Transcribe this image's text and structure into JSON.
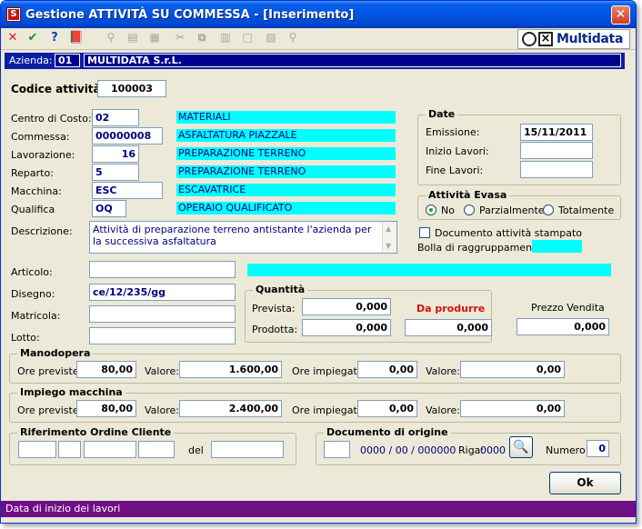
{
  "window": {
    "title": "Gestione ATTIVITÀ SU COMMESSA - [Inserimento]",
    "close_glyph": "✕"
  },
  "toolbar": {
    "buttons": [
      "close-icon",
      "confirm-icon",
      "help-icon",
      "book-icon",
      "binoculars-icon",
      "print-icon",
      "print-preview-icon",
      "cut-icon",
      "copy-icon",
      "paste-icon",
      "new-icon",
      "export-icon",
      "search-icon"
    ],
    "glyphs": [
      "✕",
      "✔",
      "?",
      "📕",
      "⚲",
      "▤",
      "▦",
      "✂",
      "⧉",
      "▥",
      "□",
      "▧",
      "⚲"
    ],
    "logo_text": "Multidata"
  },
  "azienda": {
    "label": "Azienda:",
    "code": "01",
    "name": "MULTIDATA S.r.L."
  },
  "codice": {
    "label": "Codice attività:",
    "value": "100003"
  },
  "fields": {
    "centro_costo": {
      "label": "Centro di Costo:",
      "value": "02",
      "desc": "MATERIALI"
    },
    "commessa": {
      "label": "Commessa:",
      "value": "00000008",
      "desc": "ASFALTATURA PIAZZALE"
    },
    "lavorazione": {
      "label": "Lavorazione:",
      "value": "16",
      "desc": "PREPARAZIONE TERRENO"
    },
    "reparto": {
      "label": "Reparto:",
      "value": "5",
      "desc": "PREPARAZIONE TERRENO"
    },
    "macchina": {
      "label": "Macchina:",
      "value": "ESC",
      "desc": "ESCAVATRICE"
    },
    "qualifica": {
      "label": "Qualifica",
      "value": "OQ",
      "desc": "OPERAIO QUALIFICATO"
    },
    "descrizione": {
      "label": "Descrizione:",
      "value": "Attività di preparazione terreno antistante l'azienda per la successiva asfaltatura"
    },
    "articolo": {
      "label": "Articolo:",
      "value": ""
    },
    "disegno": {
      "label": "Disegno:",
      "value": "ce/12/235/gg"
    },
    "matricola": {
      "label": "Matricola:",
      "value": ""
    },
    "lotto": {
      "label": "Lotto:",
      "value": ""
    }
  },
  "date": {
    "title": "Date",
    "emissione": {
      "label": "Emissione:",
      "value": "15/11/2011"
    },
    "inizio": {
      "label": "Inizio Lavori:",
      "value": ""
    },
    "fine": {
      "label": "Fine Lavori:",
      "value": ""
    }
  },
  "evasa": {
    "title": "Attività Evasa",
    "options": [
      {
        "label": "No",
        "selected": true
      },
      {
        "label": "Parzialmente",
        "selected": false
      },
      {
        "label": "Totalmente",
        "selected": false
      }
    ]
  },
  "stampato": {
    "label": "Documento attività stampato",
    "checked": false
  },
  "bolla": {
    "label": "Bolla di raggruppamento:",
    "value": ""
  },
  "quantita": {
    "title": "Quantità",
    "prevista": {
      "label": "Prevista:",
      "value": "0,000"
    },
    "prodotta": {
      "label": "Prodotta:",
      "value": "0,000"
    },
    "da_produrre": {
      "label": "Da produrre",
      "value": "0,000"
    },
    "prezzo": {
      "label": "Prezzo Vendita",
      "value": "0,000"
    }
  },
  "manodopera": {
    "title": "Manodopera",
    "ore_previste": {
      "label": "Ore previste:",
      "value": "80,00"
    },
    "valore1": {
      "label": "Valore:",
      "value": "1.600,00"
    },
    "ore_impiegate": {
      "label": "Ore impiegate:",
      "value": "0,00"
    },
    "valore2": {
      "label": "Valore:",
      "value": "0,00"
    }
  },
  "impiego": {
    "title": "Impiego macchina",
    "ore_previste": {
      "label": "Ore previste:",
      "value": "80,00"
    },
    "valore1": {
      "label": "Valore:",
      "value": "2.400,00"
    },
    "ore_impiegate": {
      "label": "Ore impiegate:",
      "value": "0,00"
    },
    "valore2": {
      "label": "Valore:",
      "value": "0,00"
    }
  },
  "riferimento": {
    "title": "Riferimento Ordine Cliente",
    "del_label": "del"
  },
  "documento": {
    "title": "Documento di origine",
    "ref": "0000 / 00 / 000000",
    "riga_label": "Riga:",
    "riga_value": "0000",
    "numero_label": "Numero:",
    "numero_value": "0"
  },
  "ok_button": "Ok",
  "status": "Data di inizio dei lavori",
  "colors": {
    "title": "#0054e3",
    "highlight": "#00ffff",
    "status": "#6e0f86"
  }
}
